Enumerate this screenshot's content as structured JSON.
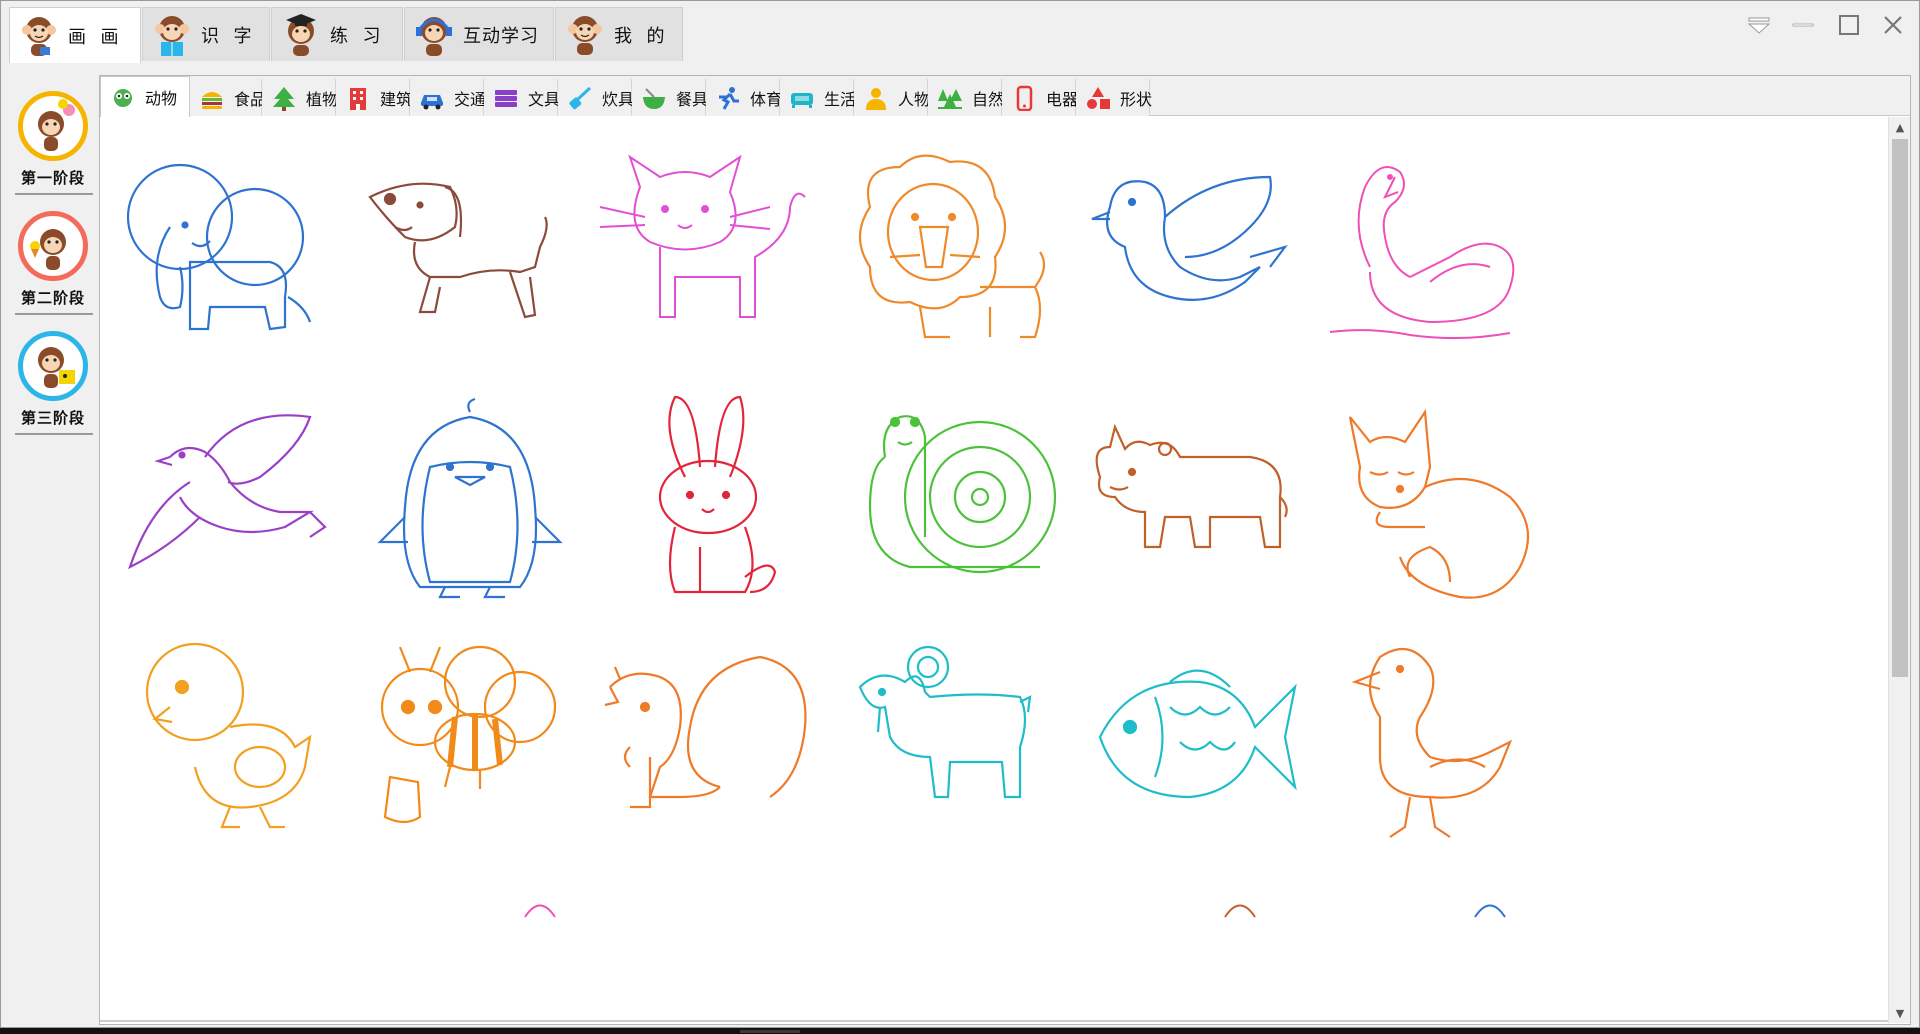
{
  "main_tabs": [
    {
      "label": "画  画",
      "active": true
    },
    {
      "label": "识  字",
      "active": false
    },
    {
      "label": "练  习",
      "active": false
    },
    {
      "label": "互动学习",
      "active": false
    },
    {
      "label": "我  的",
      "active": false
    }
  ],
  "window_controls": {
    "menu": "menu-icon",
    "minimize": "minimize-icon",
    "maximize": "maximize-icon",
    "close": "close-icon"
  },
  "stages": [
    {
      "label": "第一阶段",
      "ring_color": "#f5b400"
    },
    {
      "label": "第二阶段",
      "ring_color": "#f26b5b"
    },
    {
      "label": "第三阶段",
      "ring_color": "#2bb5e8"
    }
  ],
  "categories": [
    {
      "label": "动物",
      "icon": "animal-icon",
      "color": "#4caf50",
      "active": true
    },
    {
      "label": "食品",
      "icon": "burger-icon",
      "color": "#f5b400"
    },
    {
      "label": "植物",
      "icon": "tree-icon",
      "color": "#3cb043"
    },
    {
      "label": "建筑",
      "icon": "building-icon",
      "color": "#e5393a"
    },
    {
      "label": "交通",
      "icon": "car-icon",
      "color": "#2f6fd8"
    },
    {
      "label": "文具",
      "icon": "book-stack-icon",
      "color": "#8a3fc8"
    },
    {
      "label": "炊具",
      "icon": "spatula-icon",
      "color": "#2bb5e8"
    },
    {
      "label": "餐具",
      "icon": "bowl-icon",
      "color": "#3cb043"
    },
    {
      "label": "体育",
      "icon": "runner-icon",
      "color": "#2f6fd8"
    },
    {
      "label": "生活",
      "icon": "sofa-icon",
      "color": "#1fb6c9"
    },
    {
      "label": "人物",
      "icon": "person-icon",
      "color": "#f5b400"
    },
    {
      "label": "自然",
      "icon": "forest-icon",
      "color": "#3cb043"
    },
    {
      "label": "电器",
      "icon": "phone-icon",
      "color": "#e5393a"
    },
    {
      "label": "形状",
      "icon": "shapes-icon",
      "color": "#e5393a"
    }
  ],
  "drawings": [
    {
      "subject": "elephant",
      "color": "#2f73d0"
    },
    {
      "subject": "dog",
      "color": "#8b4a3a"
    },
    {
      "subject": "cat",
      "color": "#e24fd6"
    },
    {
      "subject": "lion",
      "color": "#ee8a2a"
    },
    {
      "subject": "bird",
      "color": "#2f73d0"
    },
    {
      "subject": "swan",
      "color": "#ef4fb6"
    },
    {
      "subject": "dove",
      "color": "#9a3fc6"
    },
    {
      "subject": "penguin",
      "color": "#2f73d0"
    },
    {
      "subject": "rabbit",
      "color": "#e2253a"
    },
    {
      "subject": "snail",
      "color": "#4cc23a"
    },
    {
      "subject": "rhino",
      "color": "#c0602a"
    },
    {
      "subject": "fox",
      "color": "#ee7a2a"
    },
    {
      "subject": "chick",
      "color": "#f2a020"
    },
    {
      "subject": "bee",
      "color": "#f28a1a"
    },
    {
      "subject": "squirrel",
      "color": "#ee7a2a"
    },
    {
      "subject": "goat",
      "color": "#1fbcc9"
    },
    {
      "subject": "fish",
      "color": "#1fbcc9"
    },
    {
      "subject": "duck",
      "color": "#ee7a2a"
    }
  ]
}
